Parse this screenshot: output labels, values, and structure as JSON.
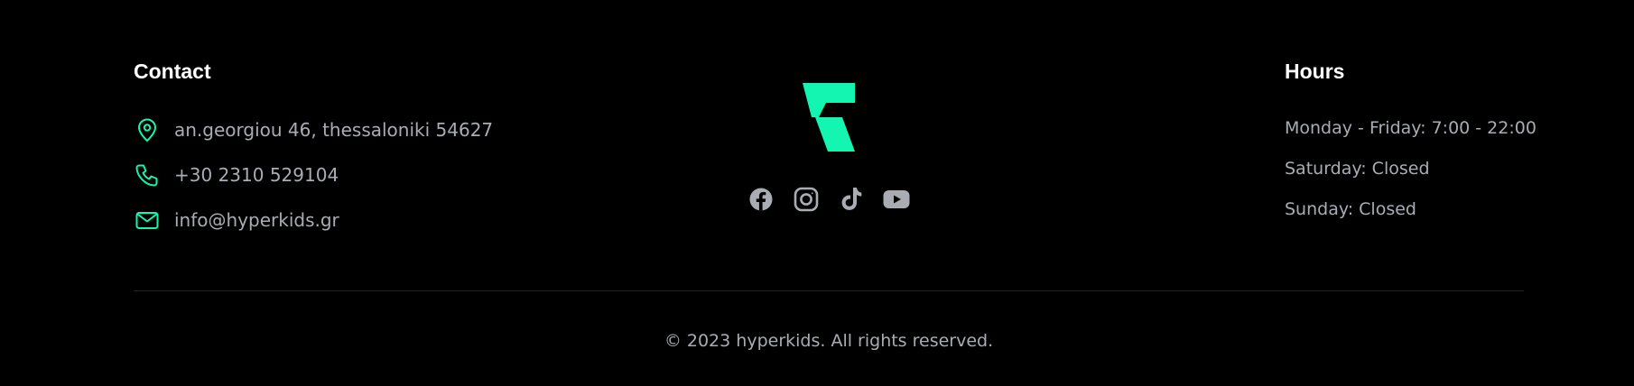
{
  "colors": {
    "background": "#000000",
    "accent": "#13f5b0",
    "text": "#a9adb3",
    "heading": "#ffffff",
    "social_icon": "#a9adb3",
    "divider": "#222428"
  },
  "contact": {
    "heading": "Contact",
    "address": {
      "icon": "map-pin-icon",
      "text": "an.georgiou 46, thessaloniki 54627"
    },
    "phone": {
      "icon": "phone-icon",
      "text": "+30 2310 529104"
    },
    "email": {
      "icon": "mail-icon",
      "text": "info@hyperkids.gr"
    }
  },
  "brand": {
    "logo_icon": "hyperkids-logo-icon",
    "socials": [
      {
        "icon": "facebook-icon"
      },
      {
        "icon": "instagram-icon"
      },
      {
        "icon": "tiktok-icon"
      },
      {
        "icon": "youtube-icon"
      }
    ]
  },
  "hours": {
    "heading": "Hours",
    "lines": [
      "Monday - Friday: 7:00 - 22:00",
      "Saturday: Closed",
      "Sunday: Closed"
    ]
  },
  "copyright": "© 2023 hyperkids. All rights reserved."
}
